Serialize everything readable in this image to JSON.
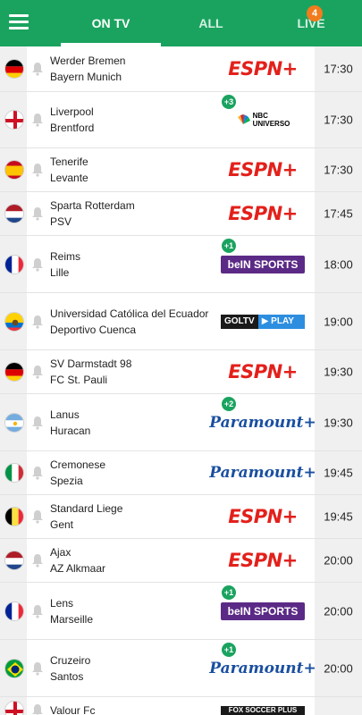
{
  "tabs": {
    "on_tv": "ON TV",
    "all": "ALL",
    "live": "LIVE",
    "live_count": "4"
  },
  "colors": {
    "header": "#1aa35f",
    "live_badge": "#f07c1e",
    "espn": "#e3201b",
    "bein": "#5b2a86",
    "paramount": "#1a4fa0"
  },
  "matches": [
    {
      "flag": "germany",
      "home": "Werder Bremen",
      "away": "Bayern Munich",
      "channel": "espn-plus",
      "channel_text": "ESPN+",
      "extra": "",
      "time": "17:30"
    },
    {
      "flag": "england",
      "home": "Liverpool",
      "away": "Brentford",
      "channel": "nbc-universo",
      "channel_text": "NBC UNIVERSO",
      "extra": "+3",
      "time": "17:30"
    },
    {
      "flag": "spain",
      "home": "Tenerife",
      "away": "Levante",
      "channel": "espn-plus",
      "channel_text": "ESPN+",
      "extra": "",
      "time": "17:30"
    },
    {
      "flag": "netherlands",
      "home": "Sparta Rotterdam",
      "away": "PSV",
      "channel": "espn-plus",
      "channel_text": "ESPN+",
      "extra": "",
      "time": "17:45"
    },
    {
      "flag": "france",
      "home": "Reims",
      "away": "Lille",
      "channel": "bein-sports",
      "channel_text": "beIN SPORTS",
      "extra": "+1",
      "time": "18:00"
    },
    {
      "flag": "ecuador",
      "home": "Universidad Católica del Ecuador",
      "away": "Deportivo Cuenca",
      "channel": "goltv-play",
      "channel_text": "GOLTV PLAY",
      "extra": "",
      "time": "19:00"
    },
    {
      "flag": "germany",
      "home": "SV Darmstadt 98",
      "away": "FC St. Pauli",
      "channel": "espn-plus",
      "channel_text": "ESPN+",
      "extra": "",
      "time": "19:30"
    },
    {
      "flag": "argentina",
      "home": "Lanus",
      "away": "Huracan",
      "channel": "paramount-plus",
      "channel_text": "Paramount+",
      "extra": "+2",
      "time": "19:30"
    },
    {
      "flag": "italy",
      "home": "Cremonese",
      "away": "Spezia",
      "channel": "paramount-plus",
      "channel_text": "Paramount+",
      "extra": "",
      "time": "19:45"
    },
    {
      "flag": "belgium",
      "home": "Standard Liege",
      "away": "Gent",
      "channel": "espn-plus",
      "channel_text": "ESPN+",
      "extra": "",
      "time": "19:45"
    },
    {
      "flag": "netherlands",
      "home": "Ajax",
      "away": "AZ Alkmaar",
      "channel": "espn-plus",
      "channel_text": "ESPN+",
      "extra": "",
      "time": "20:00"
    },
    {
      "flag": "france",
      "home": "Lens",
      "away": "Marseille",
      "channel": "bein-sports",
      "channel_text": "beIN SPORTS",
      "extra": "+1",
      "time": "20:00"
    },
    {
      "flag": "brazil",
      "home": "Cruzeiro",
      "away": "Santos",
      "channel": "paramount-plus",
      "channel_text": "Paramount+",
      "extra": "+1",
      "time": "20:00"
    },
    {
      "flag": "england",
      "home": "Valour Fc",
      "away": "",
      "channel": "fox-soccer-plus",
      "channel_text": "FOX SOCCER PLUS",
      "extra": "",
      "time": ""
    }
  ]
}
